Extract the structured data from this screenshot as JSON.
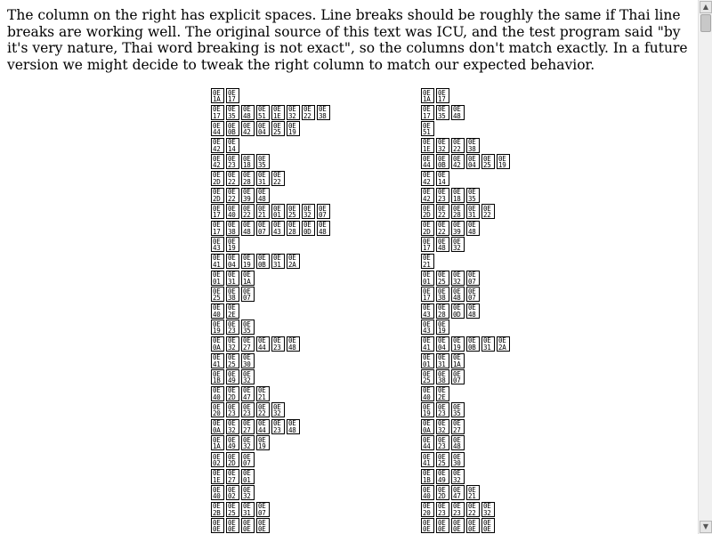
{
  "intro_text": "The column on the right has explicit spaces. Line breaks should be roughly the same if Thai line breaks are working well. The original source of this text was ICU, and the test program said \"by it's very nature, Thai word breaking is not exact\", so the columns don't match exactly. In a future version we might decide to tweak the right column to match our expected behavior.",
  "left_column": [
    [
      "1A",
      "17"
    ],
    [
      "17",
      "35",
      "48",
      "51",
      "1E",
      "32",
      "22",
      "38"
    ],
    [
      "44",
      "0B",
      "42",
      "04",
      "25",
      "19"
    ],
    [
      "42",
      "14"
    ],
    [
      "42",
      "23",
      "18",
      "35"
    ],
    [
      "2D",
      "22",
      "28",
      "31",
      "22"
    ],
    [
      "2D",
      "22",
      "39",
      "48"
    ],
    [
      "17",
      "40",
      "22",
      "21",
      "01",
      "25",
      "32",
      "07"
    ],
    [
      "17",
      "38",
      "48",
      "07",
      "43",
      "28",
      "0D",
      "48"
    ],
    [
      "43",
      "19"
    ],
    [
      "41",
      "04",
      "19",
      "0B",
      "31",
      "2A"
    ],
    [
      "01",
      "31",
      "1A"
    ],
    [
      "25",
      "38",
      "07"
    ],
    [
      "40",
      "2E"
    ],
    [
      "19",
      "23",
      "35"
    ],
    [
      "0A",
      "32",
      "27",
      "44",
      "23",
      "48"
    ],
    [
      "41",
      "25",
      "30"
    ],
    [
      "1B",
      "49",
      "32"
    ],
    [
      "40",
      "2D",
      "47",
      "21"
    ],
    [
      "20",
      "23",
      "23",
      "22",
      "32"
    ],
    [
      "0A",
      "32",
      "27",
      "44",
      "23",
      "48"
    ],
    [
      "1A",
      "49",
      "32",
      "19"
    ],
    [
      "02",
      "2D",
      "07"
    ],
    [
      "1E",
      "27",
      "01"
    ],
    [
      "40",
      "02",
      "32"
    ],
    [
      "2B",
      "25",
      "31",
      "07"
    ],
    [
      "0E",
      "0E",
      "0E",
      "0E"
    ]
  ],
  "right_column": [
    [
      "1A",
      "17"
    ],
    [
      "17",
      "35",
      "48"
    ],
    [
      "51"
    ],
    [
      "1E",
      "32",
      "22",
      "38"
    ],
    [
      "44",
      "0B",
      "42",
      "04",
      "25",
      "19"
    ],
    [
      "42",
      "14"
    ],
    [
      "42",
      "23",
      "18",
      "35"
    ],
    [
      "2D",
      "22",
      "28",
      "31",
      "22"
    ],
    [
      "2D",
      "22",
      "39",
      "48"
    ],
    [
      "17",
      "48",
      "32"
    ],
    [
      "21"
    ],
    [
      "01",
      "25",
      "32",
      "07"
    ],
    [
      "17",
      "38",
      "48",
      "07"
    ],
    [
      "43",
      "28",
      "0D",
      "48"
    ],
    [
      "43",
      "19"
    ],
    [
      "41",
      "04",
      "19",
      "0B",
      "31",
      "2A"
    ],
    [
      "01",
      "31",
      "1A"
    ],
    [
      "25",
      "38",
      "07"
    ],
    [
      "40",
      "2E"
    ],
    [
      "19",
      "23",
      "35"
    ],
    [
      "0A",
      "32",
      "27"
    ],
    [
      "44",
      "23",
      "48"
    ],
    [
      "41",
      "25",
      "30"
    ],
    [
      "1B",
      "49",
      "32"
    ],
    [
      "40",
      "2D",
      "47",
      "21"
    ],
    [
      "20",
      "23",
      "23",
      "22",
      "32"
    ],
    [
      "0E",
      "0E",
      "0E",
      "0E",
      "0E"
    ]
  ],
  "glyph_prefix": "0E",
  "scrollbar": {
    "up_arrow": "▲",
    "down_arrow": "▼"
  }
}
